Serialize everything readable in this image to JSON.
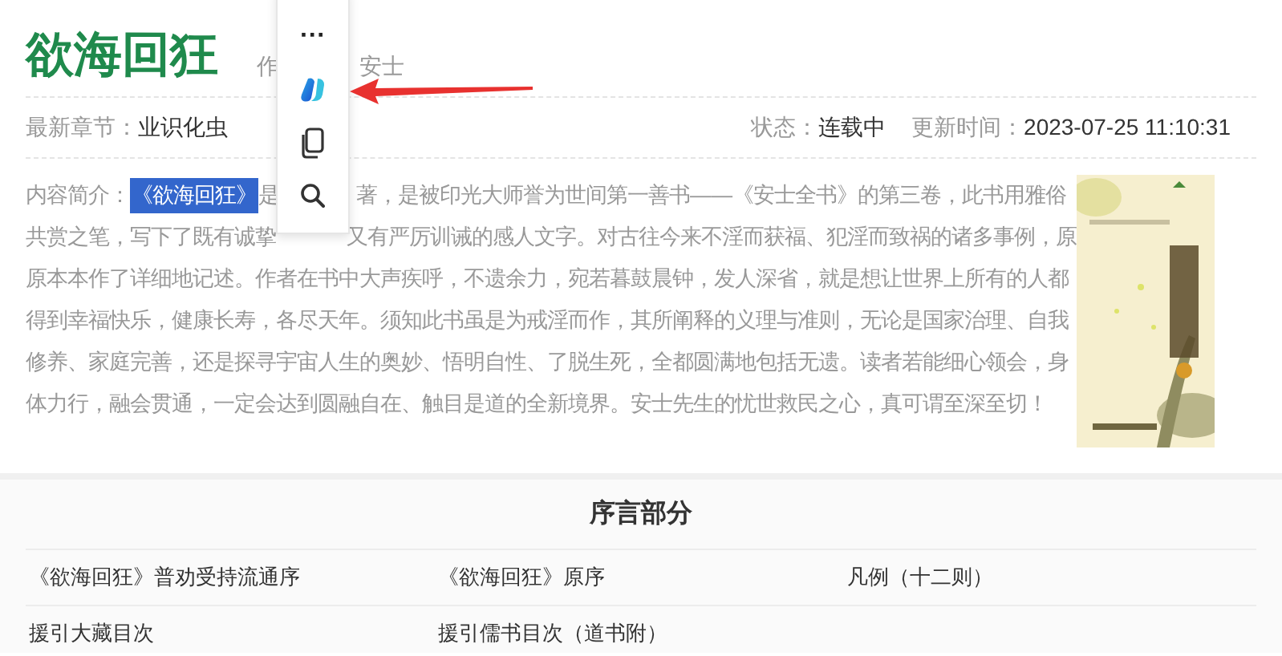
{
  "book": {
    "title": "欲海回狂",
    "author_visible_start": "作",
    "author_visible_end": "安士"
  },
  "meta": {
    "latest_label": "最新章节：",
    "latest_value": "业识化虫",
    "status_label": "状态：",
    "status_value": "连载中",
    "updated_label": "更新时间：",
    "updated_value": "2023-07-25 11:10:31"
  },
  "intro": {
    "label": "内容简介：",
    "highlight": "《欲海回狂》",
    "lines": [
      {
        "before": "是",
        "after": "著，是被印光大师誉为世间第一善书——《安士全书》的第三卷，此书用雅俗"
      },
      {
        "before": "共赏之笔，写下了既有诚挚",
        "after": "又有严厉训诫的感人文字。对古往今来不淫而获福、犯淫而致祸的诸多事例，原"
      },
      {
        "before": "原本本作了详细地记述。作者在书中大声疾呼，不遗余力，宛若暮鼓晨钟，发人深省，就是想让世界上所有的人都"
      },
      {
        "before": "得到幸福快乐，健康长寿，各尽天年。须知此书虽是为戒淫而作，其所阐释的义理与准则，无论是国家治理、自我"
      },
      {
        "before": "修养、家庭完善，还是探寻宇宙人生的奥妙、悟明自性、了脱生死，全都圆满地包括无遗。读者若能细心领会，身"
      },
      {
        "before": "体力行，融会贯通，一定会达到圆融自在、触目是道的全新境界。安士先生的忧世救民之心，真可谓至深至切！"
      }
    ]
  },
  "section": {
    "title": "序言部分",
    "chapters": [
      [
        "《欲海回狂》普劝受持流通序",
        "《欲海回狂》原序",
        "凡例（十二则）"
      ],
      [
        "援引大藏目次",
        "援引儒书目次（道书附）"
      ]
    ]
  },
  "popup_menu": {
    "items": [
      {
        "kind": "more",
        "glyph": "···"
      },
      {
        "kind": "copilot"
      },
      {
        "kind": "copy"
      },
      {
        "kind": "search"
      }
    ]
  }
}
